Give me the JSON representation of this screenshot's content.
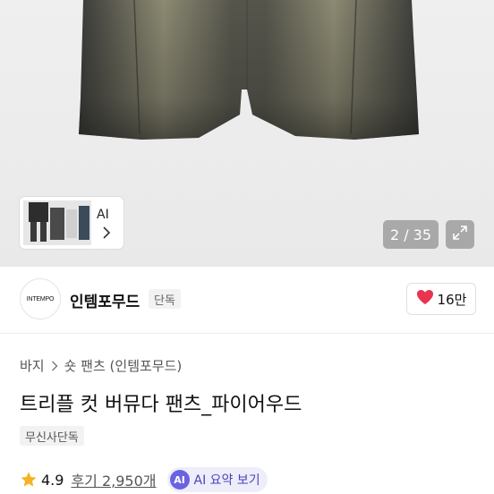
{
  "gallery": {
    "thumbnail_label": "AI",
    "counter": "2 / 35"
  },
  "brand": {
    "logo_text": "INTEMPO",
    "name": "인템포무드",
    "tag": "단독",
    "likes": "16만",
    "heart_color": "#e8344e"
  },
  "product": {
    "breadcrumb": [
      "바지",
      "숏 팬츠 (인템포무드)"
    ],
    "title": "트리플 컷 버뮤다 팬츠_파이어우드",
    "badge": "무신사단독",
    "rating": "4.9",
    "review_label": "후기 2,950개",
    "ai_badge": "AI",
    "ai_summary_label": "AI 요약 보기"
  },
  "icons": {
    "star": "star-icon",
    "heart": "heart-icon",
    "expand": "expand-icon",
    "chevron": "chevron-right-icon"
  },
  "colors": {
    "star": "#f5b324",
    "ai_accent": "#6b62e0"
  }
}
